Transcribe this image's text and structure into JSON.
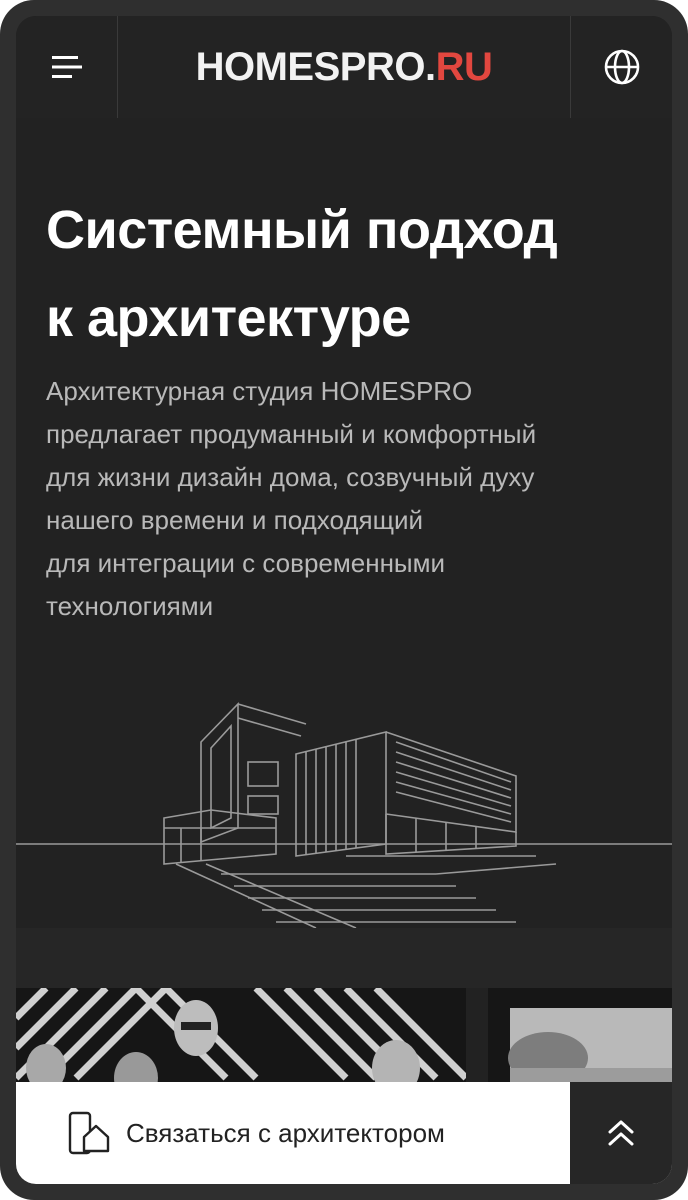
{
  "header": {
    "logo_main": "HOMESPRO.",
    "logo_accent": "RU",
    "menu_icon": "hamburger-menu-icon",
    "language_icon": "globe-icon"
  },
  "hero": {
    "title_lines": [
      "Системный подход",
      "к архитектуре"
    ],
    "description_lines": [
      "Архитектурная студия HOMESPRO",
      "предлагает продуманный и комфортный",
      "для жизни дизайн дома, созвучный духу",
      "нашего времени и подходящий",
      "для интеграции с современными",
      "технологиями"
    ]
  },
  "cta": {
    "contact_label": "Связаться с архитектором",
    "contact_icon": "phone-house-icon",
    "scroll_top_icon": "double-chevron-up-icon"
  },
  "colors": {
    "accent": "#e2473f",
    "background": "#222222",
    "header": "#232323",
    "text_primary": "#ffffff",
    "text_secondary": "#b9b9b9"
  }
}
